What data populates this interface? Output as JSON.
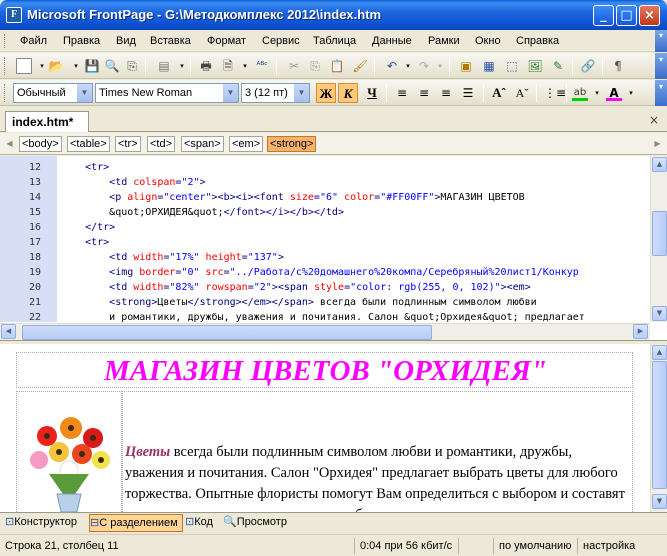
{
  "window": {
    "title": "Microsoft FrontPage - G:\\Методкомплекс 2012\\index.htm",
    "app_icon": "frontpage-icon"
  },
  "menu": [
    "Файл",
    "Правка",
    "Вид",
    "Вставка",
    "Формат",
    "Сервис",
    "Таблица",
    "Данные",
    "Рамки",
    "Окно",
    "Справка"
  ],
  "formatting": {
    "style": "Обычный",
    "font": "Times New Roman",
    "size": "3  (12 пт)",
    "bold": "Ж",
    "italic": "К",
    "underline": "Ч"
  },
  "document_tab": {
    "name": "index.htm*",
    "close": "×"
  },
  "tag_selector": [
    "<body>",
    "<table>",
    "<tr>",
    "<td>",
    "<span>",
    "<em>",
    "<strong>"
  ],
  "tag_selected": "<strong>",
  "code": {
    "line_numbers": [
      "12",
      "13",
      "14",
      "15",
      "16",
      "17",
      "18",
      "19",
      "20",
      "21",
      "22"
    ],
    "lines": [
      {
        "indent": "    ",
        "parts": [
          [
            "k",
            "<tr>"
          ]
        ]
      },
      {
        "indent": "        ",
        "parts": [
          [
            "k",
            "<td "
          ],
          [
            "a",
            "colspan"
          ],
          [
            "k",
            "="
          ],
          [
            "v",
            "\"2\""
          ],
          [
            "k",
            ">"
          ]
        ]
      },
      {
        "indent": "        ",
        "parts": [
          [
            "k",
            "<p "
          ],
          [
            "a",
            "align"
          ],
          [
            "k",
            "="
          ],
          [
            "v",
            "\"center\""
          ],
          [
            "k",
            "><b><i><font "
          ],
          [
            "a",
            "size"
          ],
          [
            "k",
            "="
          ],
          [
            "v",
            "\"6\""
          ],
          [
            "k",
            " "
          ],
          [
            "a",
            "color"
          ],
          [
            "k",
            "="
          ],
          [
            "v",
            "\"#FF00FF\""
          ],
          [
            "k",
            ">"
          ],
          [
            "t",
            "МАГАЗИН ЦВЕТОВ"
          ]
        ]
      },
      {
        "indent": "        ",
        "parts": [
          [
            "t",
            "&quot;ОРХИДЕЯ&quot;"
          ],
          [
            "k",
            "</font></i></b></td>"
          ]
        ]
      },
      {
        "indent": "    ",
        "parts": [
          [
            "k",
            "</tr>"
          ]
        ]
      },
      {
        "indent": "    ",
        "parts": [
          [
            "k",
            "<tr>"
          ]
        ]
      },
      {
        "indent": "        ",
        "parts": [
          [
            "k",
            "<td "
          ],
          [
            "a",
            "width"
          ],
          [
            "k",
            "="
          ],
          [
            "v",
            "\"17%\""
          ],
          [
            "k",
            " "
          ],
          [
            "a",
            "height"
          ],
          [
            "k",
            "="
          ],
          [
            "v",
            "\"137\""
          ],
          [
            "k",
            ">"
          ]
        ]
      },
      {
        "indent": "        ",
        "parts": [
          [
            "k",
            "<img "
          ],
          [
            "a",
            "border"
          ],
          [
            "k",
            "="
          ],
          [
            "v",
            "\"0\""
          ],
          [
            "k",
            " "
          ],
          [
            "a",
            "src"
          ],
          [
            "k",
            "="
          ],
          [
            "v",
            "\"../Работа/с%20домашнего%20компа/Серебряный%20лист1/Конкур"
          ]
        ]
      },
      {
        "indent": "        ",
        "parts": [
          [
            "k",
            "<td "
          ],
          [
            "a",
            "width"
          ],
          [
            "k",
            "="
          ],
          [
            "v",
            "\"82%\""
          ],
          [
            "k",
            " "
          ],
          [
            "a",
            "rowspan"
          ],
          [
            "k",
            "="
          ],
          [
            "v",
            "\"2\""
          ],
          [
            "k",
            "><span "
          ],
          [
            "a",
            "style"
          ],
          [
            "k",
            "="
          ],
          [
            "v",
            "\"color: rgb(255, 0, 102)\""
          ],
          [
            "k",
            "><em>"
          ]
        ]
      },
      {
        "indent": "        ",
        "parts": [
          [
            "k",
            "<strong>"
          ],
          [
            "t",
            "Цветы"
          ],
          [
            "k",
            "</strong></em></span>"
          ],
          [
            "t",
            " всегда были подлинным символом любви"
          ]
        ]
      },
      {
        "indent": "        ",
        "parts": [
          [
            "t",
            "и романтики, дружбы, уважения и почитания. Салон &quot;Орхидея&quot; предлагает"
          ]
        ]
      }
    ]
  },
  "design": {
    "heading": "МАГАЗИН ЦВЕТОВ \"ОРХИДЕЯ\"",
    "paragraph_em": "Цветы",
    "paragraph_rest": " всегда были подлинным символом любви и романтики, дружбы, уважения и почитания. Салон \"Орхидея\" предлагает выбрать цветы для любого торжества. Опытные флористы помогут Вам определиться с выбором и составят оригинальные, стильные и красивые букеты."
  },
  "view_tabs": [
    {
      "label": "Конструктор",
      "icon": "design-view-icon"
    },
    {
      "label": "С разделением",
      "icon": "split-view-icon"
    },
    {
      "label": "Код",
      "icon": "code-view-icon"
    },
    {
      "label": "Просмотр",
      "icon": "preview-icon"
    }
  ],
  "view_selected": "С разделением",
  "status": {
    "position": "Строка 21, столбец 11",
    "download": "0:04 при 56 кбит/с",
    "dims": "",
    "mode": "по умолчанию",
    "custom": "настройка"
  }
}
